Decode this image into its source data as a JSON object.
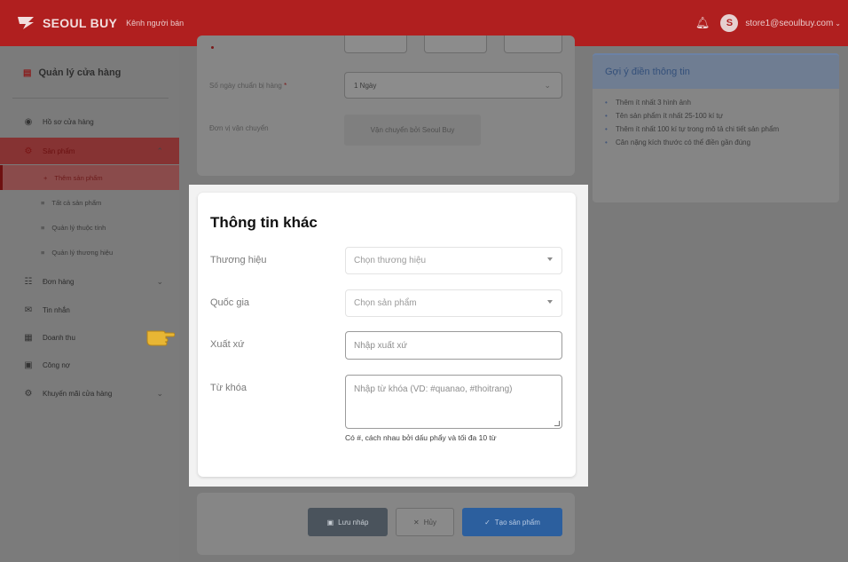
{
  "topbar": {
    "brand": "SEOUL BUY",
    "channel": "Kênh người bán",
    "user_initial": "S",
    "user_email": "store1@seoulbuy.com"
  },
  "sidebar": {
    "title": "Quản lý cửa hàng",
    "items": [
      {
        "label": "Hồ sơ cửa hàng"
      },
      {
        "label": "Sản phẩm"
      },
      {
        "label": "Đơn hàng"
      },
      {
        "label": "Tin nhắn"
      },
      {
        "label": "Doanh thu"
      },
      {
        "label": "Công nợ"
      },
      {
        "label": "Khuyến mãi cửa hàng"
      }
    ],
    "subitems": [
      {
        "label": "Thêm sản phẩm"
      },
      {
        "label": "Tất cả sản phẩm"
      },
      {
        "label": "Quản lý thuộc tính"
      },
      {
        "label": "Quản lý thương hiệu"
      }
    ]
  },
  "shipping_card": {
    "prep_days_label": "Số ngày chuẩn bị hàng",
    "prep_days_required": "*",
    "prep_days_value": "1 Ngày",
    "carrier_label": "Đơn vị vận chuyển",
    "carrier_value": "Vận chuyển bởi Seoul Buy"
  },
  "suggestions": {
    "title": "Gợi ý điền thông tin",
    "items": [
      "Thêm ít nhất 3 hình ảnh",
      "Tên sản phẩm ít nhất 25-100 kí tự",
      "Thêm ít nhất 100 kí tự trong mô tả chi tiết sản phẩm",
      "Cân nặng kích thước có thể điền gần đúng"
    ]
  },
  "modal": {
    "title": "Thông tin khác",
    "brand_label": "Thương hiệu",
    "brand_placeholder": "Chọn thương hiệu",
    "country_label": "Quốc gia",
    "country_placeholder": "Chọn sản phẩm",
    "origin_label": "Xuất xứ",
    "origin_placeholder": "Nhập xuất xứ",
    "keyword_label": "Từ khóa",
    "keyword_placeholder": "Nhập từ khóa (VD: #quanao, #thoitrang)",
    "keyword_hint": "Có #, cách nhau bởi dấu phẩy và tối đa 10 từ"
  },
  "actions": {
    "draft": "Lưu nháp",
    "cancel": "Hủy",
    "create": "Tạo sản phẩm"
  }
}
